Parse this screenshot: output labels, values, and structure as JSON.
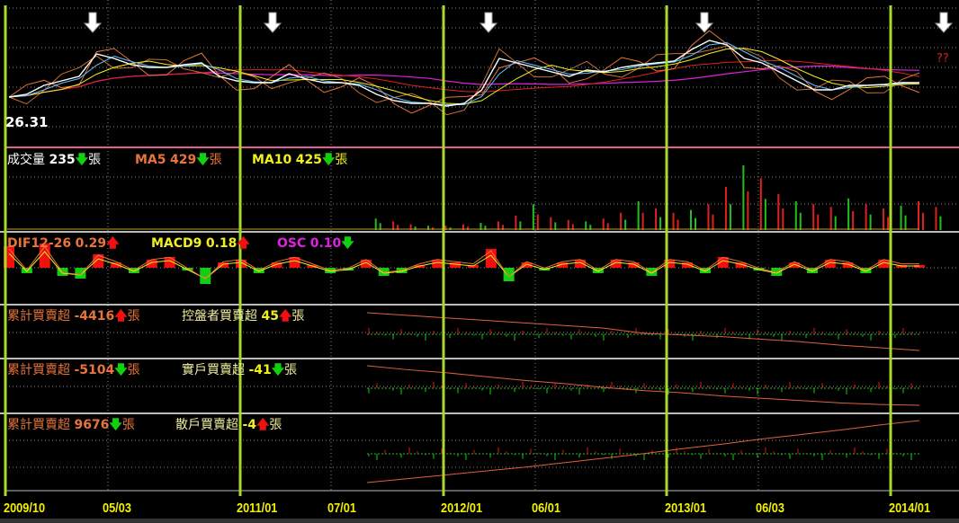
{
  "price_label": "26.31",
  "unknown_marker": "??",
  "volume": {
    "title": "成交量",
    "value": "235",
    "dir": "down",
    "unit": "張",
    "ma5_label": "MA5",
    "ma5": "429",
    "ma5_dir": "down",
    "ma10_label": "MA10",
    "ma10": "425",
    "ma10_dir": "down"
  },
  "macd": {
    "dif_label": "DIF12-26",
    "dif": "0.29",
    "dif_dir": "up",
    "macd_label": "MACD9",
    "macd": "0.18",
    "macd_dir": "up",
    "osc_label": "OSC",
    "osc": "0.10",
    "osc_dir": "down"
  },
  "panels": [
    {
      "cum_label": "累計買賣超",
      "cum": "-4416",
      "cum_dir": "up",
      "unit": "張",
      "name": "控盤者買賣超",
      "value": "45",
      "dir": "up"
    },
    {
      "cum_label": "累計買賣超",
      "cum": "-5104",
      "cum_dir": "down",
      "unit": "張",
      "name": "實戶買賣超",
      "value": "-41",
      "dir": "down"
    },
    {
      "cum_label": "累計買賣超",
      "cum": "9676",
      "cum_dir": "down",
      "unit": "張",
      "name": "散戶買賣超",
      "value": "-4",
      "dir": "up"
    }
  ],
  "arrows": {
    "up": "🡅",
    "down": "🡇"
  },
  "colors": {
    "grid_vertical": "#a8d82a",
    "ma5": "#e8743b",
    "ma10": "#f0f020",
    "osc": "#e020e0",
    "up": "#f01010",
    "down": "#10d010"
  },
  "chart_data": {
    "type": "line",
    "x_ticks": [
      "2009/10",
      "05/03",
      "2011/01",
      "07/01",
      "2012/01",
      "06/01",
      "2013/01",
      "06/03",
      "2014/01"
    ],
    "price": [
      30.4,
      31,
      33,
      34,
      35,
      40,
      39,
      37.6,
      37,
      37,
      37.6,
      38,
      35,
      34,
      33.6,
      33.6,
      35.6,
      34.4,
      33.6,
      33.6,
      33,
      31,
      29.6,
      29,
      29,
      28.4,
      29,
      32,
      39,
      38,
      37,
      36,
      35,
      36.4,
      36,
      37,
      37.6,
      38,
      38.4,
      41,
      43,
      42,
      39,
      38,
      36,
      34,
      32,
      32,
      33,
      33,
      33.2,
      33.6,
      33.6
    ],
    "price_ylim": [
      26,
      48
    ],
    "volume": [
      0,
      0,
      0,
      0,
      0,
      0,
      0,
      0,
      0,
      0,
      0,
      0,
      0,
      0,
      0,
      0,
      0,
      0,
      0,
      0,
      0,
      8,
      6,
      4,
      3,
      3,
      4,
      5,
      6,
      10,
      18,
      9,
      7,
      6,
      8,
      12,
      20,
      15,
      12,
      14,
      18,
      30,
      45,
      36,
      25,
      20,
      18,
      16,
      22,
      18,
      15,
      17,
      20,
      16
    ],
    "osc": [
      0.8,
      -0.2,
      0.9,
      -0.3,
      -0.4,
      0.5,
      0.2,
      -0.2,
      0.3,
      0.4,
      -0.1,
      -0.6,
      0.2,
      0.3,
      -0.2,
      0.2,
      0.4,
      0.1,
      -0.2,
      -0.1,
      0.3,
      -0.3,
      -0.2,
      0.1,
      0.3,
      0.2,
      0.1,
      0.7,
      -0.5,
      0.2,
      -0.1,
      0.2,
      0.3,
      -0.2,
      0.3,
      0.2,
      -0.3,
      0.3,
      0.2,
      -0.2,
      0.4,
      0.2,
      -0.1,
      -0.3,
      0.2,
      -0.2,
      0.3,
      0.2,
      -0.2,
      0.3,
      0.1,
      0.1
    ],
    "cumulative": [
      [
        0,
        -300,
        -600,
        -900,
        -1200,
        -1500,
        -1800,
        -2400,
        -2600,
        -2800,
        -3100,
        -3400,
        -3800,
        -4100,
        -4416
      ],
      [
        0,
        -500,
        -900,
        -1400,
        -1900,
        -2300,
        -2800,
        -3200,
        -3500,
        -3900,
        -4200,
        -4500,
        -4800,
        -5000,
        -5104
      ],
      [
        0,
        600,
        1200,
        1800,
        2400,
        3100,
        3800,
        4500,
        5300,
        6000,
        6800,
        7500,
        8200,
        9000,
        9676
      ]
    ]
  }
}
